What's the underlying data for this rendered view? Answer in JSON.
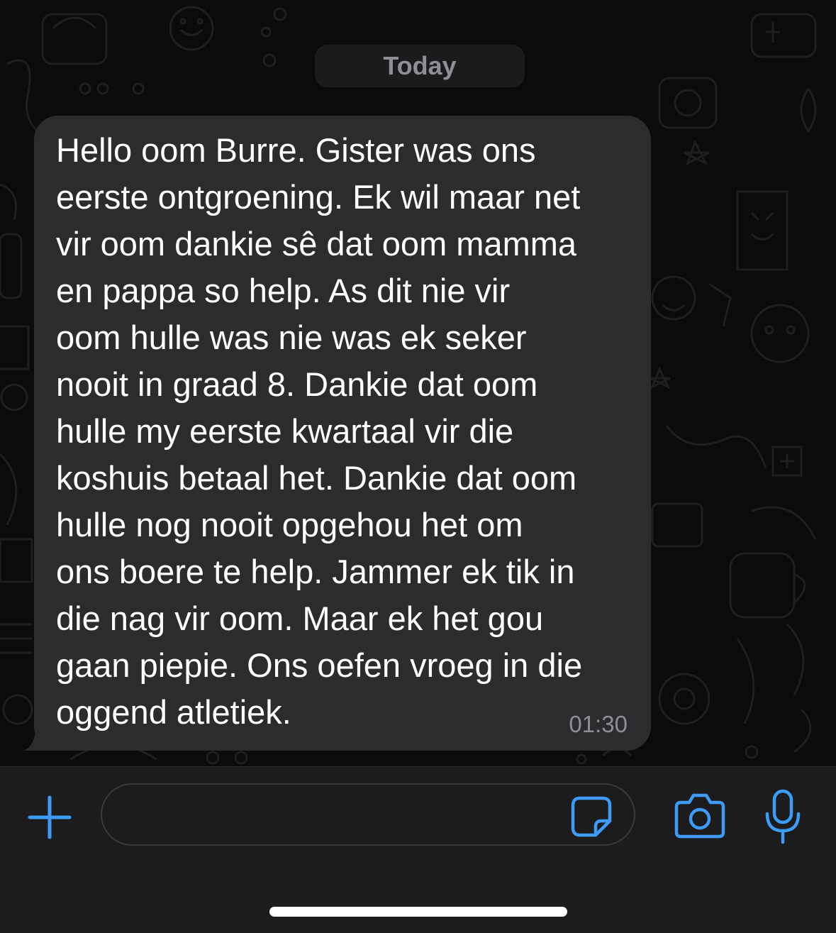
{
  "chat": {
    "date_label": "Today",
    "message": {
      "text": "Hello oom Burre. Gister was ons\neerste ontgroening. Ek wil maar net\nvir oom dankie sê dat oom mamma\nen pappa so help. As dit nie vir\noom hulle was nie was ek seker\nnooit in graad 8. Dankie dat oom\nhulle my eerste kwartaal vir die\nkoshuis betaal het. Dankie dat oom\nhulle nog nooit opgehou het om\nons boere te help. Jammer ek tik in\ndie nag vir oom. Maar ek het gou\ngaan piepie. Ons oefen vroeg in die\noggend atletiek.",
      "time": "01:30"
    }
  },
  "composer": {
    "input_value": "",
    "icons": [
      "plus-icon",
      "sticker-icon",
      "camera-icon",
      "microphone-icon"
    ]
  },
  "colors": {
    "background": "#0b0b0b",
    "bubble": "#2c2c2e",
    "accent": "#3d9bf5",
    "secondary_text": "#8e8e93",
    "composer_bar": "#1c1c1e"
  }
}
